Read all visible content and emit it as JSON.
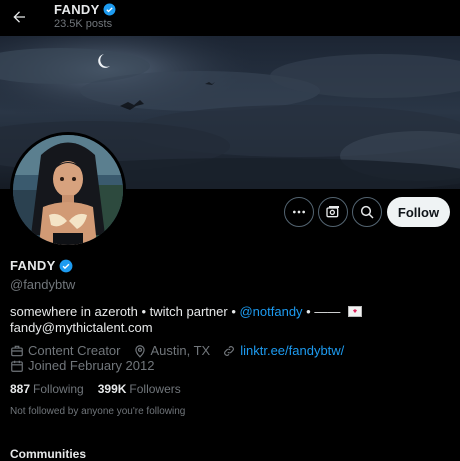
{
  "header": {
    "name": "FANDY",
    "posts_count": "23.5K posts"
  },
  "profile": {
    "display_name": "FANDY",
    "handle": "@fandybtw",
    "bio_text": "somewhere in azeroth • twitch partner • ",
    "bio_mention": "@notfandy",
    "bio_separator": " • ——",
    "bio_email": "fandy@mythictalent.com",
    "category": "Content Creator",
    "location": "Austin, TX",
    "website": "linktr.ee/fandybtw/",
    "joined": "Joined February 2012"
  },
  "stats": {
    "following_count": "887",
    "following_label": "Following",
    "followers_count": "399K",
    "followers_label": "Followers"
  },
  "not_followed_text": "Not followed by anyone you're following",
  "actions": {
    "follow_label": "Follow"
  },
  "section_title": "Communities",
  "colors": {
    "accent": "#1d9bf0",
    "follow_bg": "#eff3f4",
    "muted": "#71767b"
  },
  "icons": [
    "back-arrow-icon",
    "verified-badge-icon",
    "more-icon",
    "subscribe-icon",
    "search-icon",
    "briefcase-icon",
    "location-pin-icon",
    "link-icon",
    "calendar-icon",
    "envelope-icon"
  ]
}
